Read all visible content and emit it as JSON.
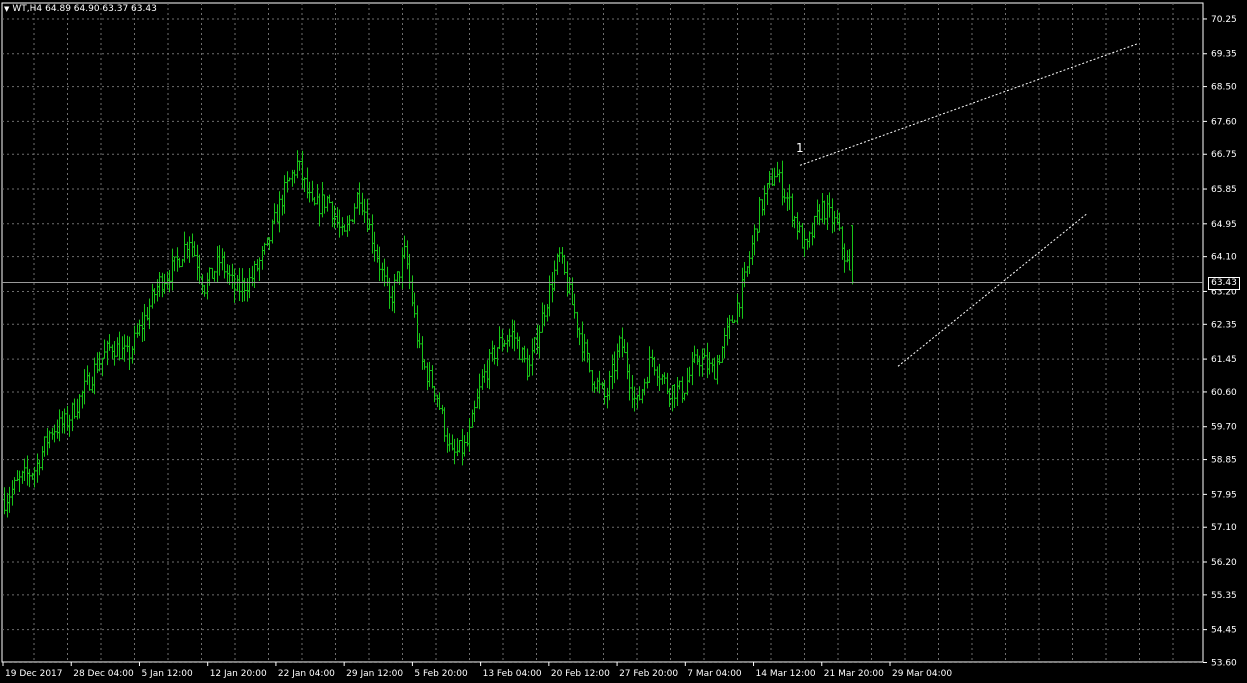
{
  "header": {
    "symbol_label": "WT,H4",
    "ohlc_label": "64.89 64.90 63.37 63.43",
    "menu_icon": "triangle-down-icon"
  },
  "current_price_label": "63.43",
  "annotation_label": "1",
  "colors": {
    "background": "#000000",
    "grid": "#6e6e6e",
    "bars": "#18c418",
    "axis": "#ffffff",
    "trendline": "#ffffff"
  },
  "chart_data": {
    "type": "bar",
    "subtype": "ohlc",
    "symbol": "WT",
    "timeframe": "H4",
    "last_ohlc": {
      "open": 64.89,
      "high": 64.9,
      "low": 63.37,
      "close": 63.43
    },
    "ylim": [
      53.6,
      70.65
    ],
    "y_ticks": [
      "70.25",
      "69.35",
      "68.50",
      "67.60",
      "66.75",
      "65.85",
      "64.95",
      "64.10",
      "63.20",
      "62.35",
      "61.45",
      "60.60",
      "59.70",
      "58.85",
      "57.95",
      "57.10",
      "56.20",
      "55.35",
      "54.45",
      "53.60"
    ],
    "x_ticks": [
      "19 Dec 2017",
      "28 Dec 04:00",
      "5 Jan 12:00",
      "12 Jan 20:00",
      "22 Jan 04:00",
      "29 Jan 12:00",
      "5 Feb 20:00",
      "13 Feb 04:00",
      "20 Feb 12:00",
      "27 Feb 20:00",
      "7 Mar 04:00",
      "14 Mar 12:00",
      "21 Mar 20:00",
      "29 Mar 04:00"
    ],
    "price_path": [
      57.8,
      58.3,
      58.6,
      59.6,
      59.8,
      60.5,
      61.3,
      61.8,
      61.5,
      62.4,
      63.4,
      63.8,
      64.6,
      63.3,
      64.0,
      63.2,
      63.5,
      64.3,
      65.6,
      66.5,
      65.3,
      65.6,
      64.5,
      65.8,
      64.4,
      62.9,
      64.2,
      61.4,
      60.6,
      58.9,
      59.2,
      60.9,
      61.8,
      62.1,
      61.1,
      62.7,
      64.1,
      62.6,
      61.1,
      60.4,
      61.9,
      60.2,
      61.5,
      60.7,
      60.6,
      61.5,
      61.1,
      62.2,
      63.4,
      65.3,
      66.3,
      65.4,
      64.2,
      65.4,
      64.9,
      63.4
    ],
    "bar_count": 340,
    "grid": true,
    "legend": "none"
  }
}
